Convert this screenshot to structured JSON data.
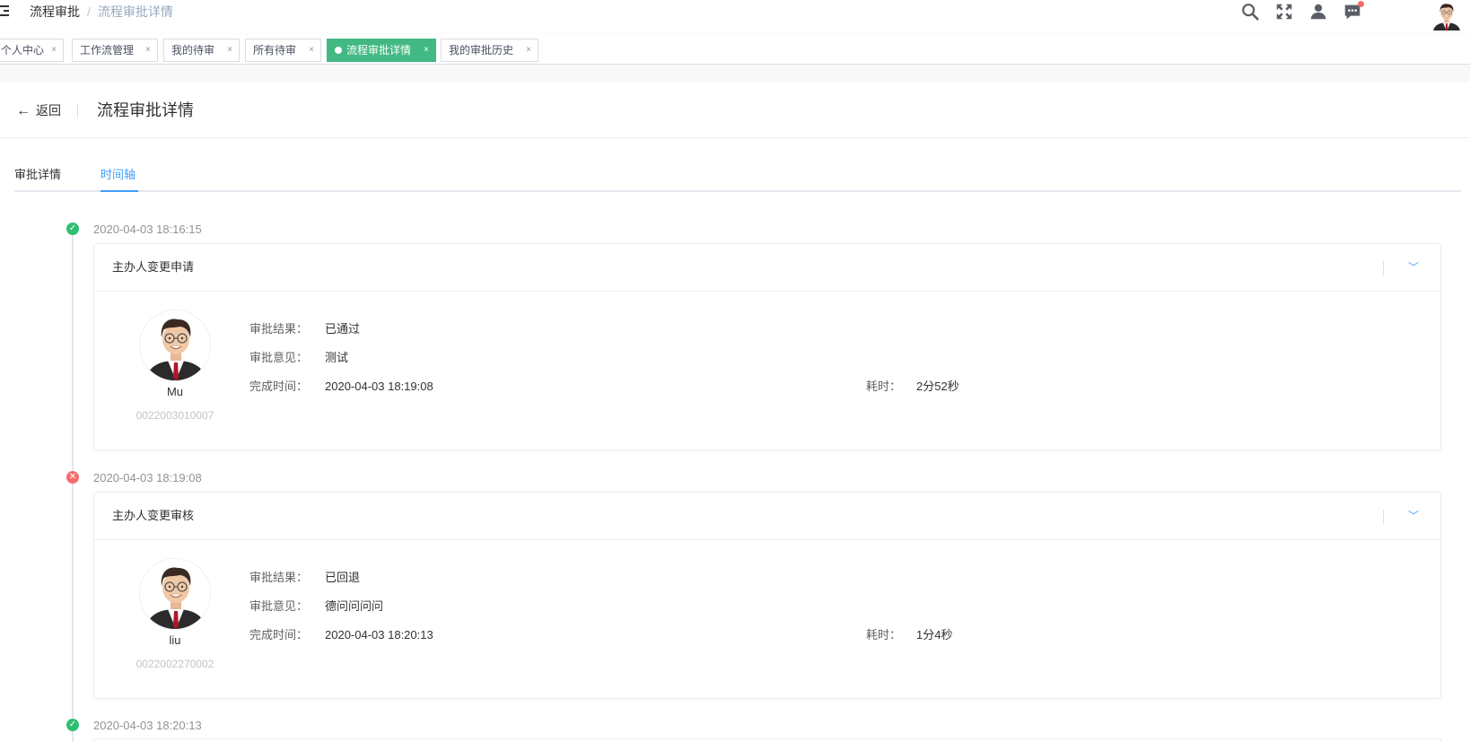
{
  "navbar": {
    "breadcrumb": [
      "流程审批",
      "流程审批详情"
    ],
    "breadcrumb_separator": "/",
    "icons": [
      "search-icon",
      "fullscreen-icon",
      "user-icon",
      "message-icon"
    ]
  },
  "tags": [
    {
      "label": "个人中心",
      "close": "×"
    },
    {
      "label": "工作流管理",
      "close": "×"
    },
    {
      "label": "我的待审",
      "close": "×"
    },
    {
      "label": "所有待审",
      "close": "×"
    },
    {
      "label": "流程审批详情",
      "close": "×",
      "active": true
    },
    {
      "label": "我的审批历史",
      "close": "×"
    }
  ],
  "page_header": {
    "back_arrow": "←",
    "back_label": "返回",
    "title": "流程审批详情"
  },
  "tabs": [
    {
      "label": "审批详情",
      "active": false
    },
    {
      "label": "时间轴",
      "active": true
    }
  ],
  "colors": {
    "accent": "#409eff",
    "tag_active": "#42b983",
    "success": "#2fbf71",
    "danger": "#f56c6c"
  },
  "timeline": [
    {
      "time": "2020-04-03 18:16:15",
      "status": "success",
      "status_icon": "✓",
      "title": "主办人变更申请",
      "collapse_icon": "﹀",
      "user": {
        "name": "Mu",
        "code": "0022003010007"
      },
      "result_label": "审批结果：",
      "result": "已通过",
      "opinion_label": "审批意见：",
      "opinion": "测试",
      "finish_label": "完成时间：",
      "finish": "2020-04-03 18:19:08",
      "duration_label": "耗时：",
      "duration": "2分52秒"
    },
    {
      "time": "2020-04-03 18:19:08",
      "status": "rejected",
      "status_icon": "✕",
      "title": "主办人变更审核",
      "collapse_icon": "﹀",
      "user": {
        "name": "liu",
        "code": "0022002270002"
      },
      "result_label": "审批结果：",
      "result": "已回退",
      "opinion_label": "审批意见：",
      "opinion": "德问问问问",
      "finish_label": "完成时间：",
      "finish": "2020-04-03 18:20:13",
      "duration_label": "耗时：",
      "duration": "1分4秒"
    },
    {
      "time": "2020-04-03 18:20:13",
      "status": "success",
      "status_icon": "✓"
    }
  ]
}
